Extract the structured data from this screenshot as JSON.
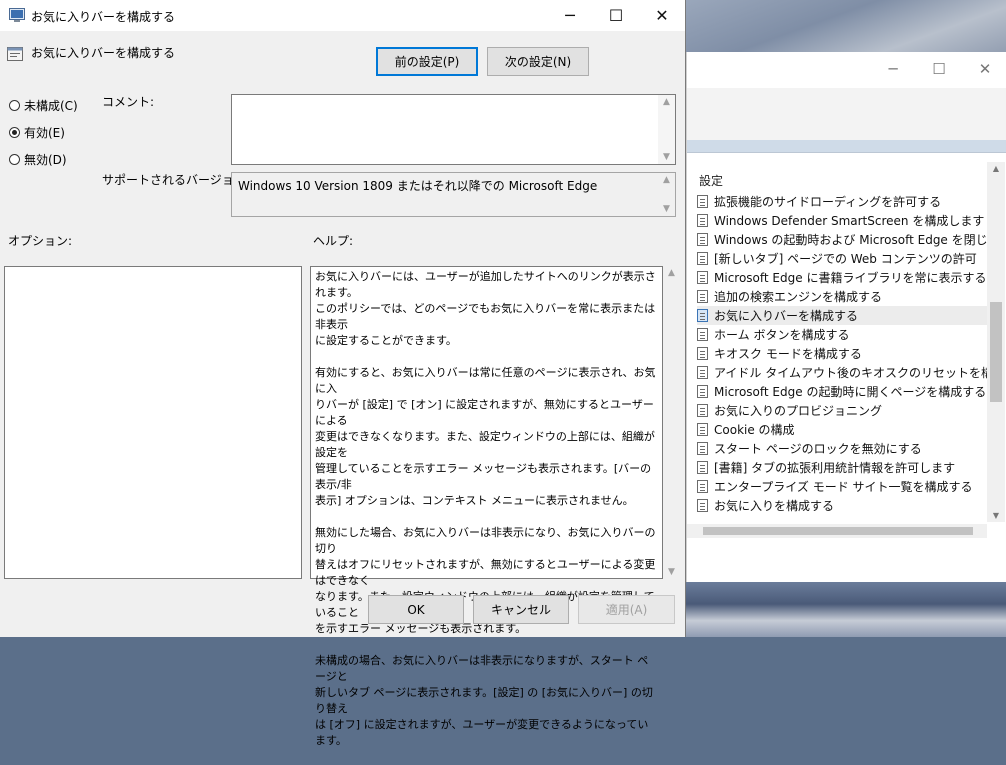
{
  "dialog": {
    "title": "お気に入りバーを構成する",
    "header": "お気に入りバーを構成する",
    "prev_button": "前の設定(P)",
    "next_button": "次の設定(N)",
    "radio_not_configured": "未構成(C)",
    "radio_enabled": "有効(E)",
    "radio_disabled": "無効(D)",
    "comment_label": "コメント:",
    "supported_label": "サポートされるバージョン:",
    "supported_value": "Windows 10 Version 1809 またはそれ以降での Microsoft Edge",
    "options_label": "オプション:",
    "help_label": "ヘルプ:",
    "help_paragraphs": [
      "お気に入りバーには、ユーザーが追加したサイトへのリンクが表示されます。\nこのポリシーでは、どのページでもお気に入りバーを常に表示または非表示\nに設定することができます。",
      "有効にすると、お気に入りバーは常に任意のページに表示され、お気に入\nりバーが [設定] で [オン] に設定されますが、無効にするとユーザーによる\n変更はできなくなります。また、設定ウィンドウの上部には、組織が設定を\n管理していることを示すエラー メッセージも表示されます。[バーの表示/非\n表示] オプションは、コンテキスト メニューに表示されません。",
      "無効にした場合、お気に入りバーは非表示になり、お気に入りバーの切り\n替えはオフにリセットされますが、無効にするとユーザーによる変更はできなく\nなります。また、設定ウィンドウの上部には、組織が設定を管理していること\nを示すエラー メッセージも表示されます。",
      "未構成の場合、お気に入りバーは非表示になりますが、スタート ページと\n新しいタブ ページに表示されます。[設定] の [お気に入りバー] の切り替え\nは [オフ] に設定されますが、ユーザーが変更できるようになっています。"
    ],
    "ok_button": "OK",
    "cancel_button": "キャンセル",
    "apply_button": "適用(A)"
  },
  "background_window": {
    "header": "設定",
    "items": [
      "拡張機能のサイドローディングを許可する",
      "Windows Defender SmartScreen を構成します",
      "Windows の起動時および Microsoft Edge を閉じるたび",
      "[新しいタブ] ページでの Web コンテンツの許可",
      "Microsoft Edge に書籍ライブラリを常に表示する",
      "追加の検索エンジンを構成する",
      "お気に入りバーを構成する",
      "ホーム ボタンを構成する",
      "キオスク モードを構成する",
      "アイドル タイムアウト後のキオスクのリセットを構成する",
      "Microsoft Edge の起動時に開くページを構成する",
      "お気に入りのプロビジョニング",
      "Cookie の構成",
      "スタート ページのロックを無効にする",
      "[書籍] タブの拡張利用統計情報を許可します",
      "エンタープライズ モード サイト一覧を構成する",
      "お気に入りを構成する"
    ],
    "selected_index": 6
  },
  "icons": {
    "window_controls": [
      "minimize-icon",
      "maximize-icon",
      "close-icon"
    ],
    "policy": "policy-setting-icon"
  }
}
